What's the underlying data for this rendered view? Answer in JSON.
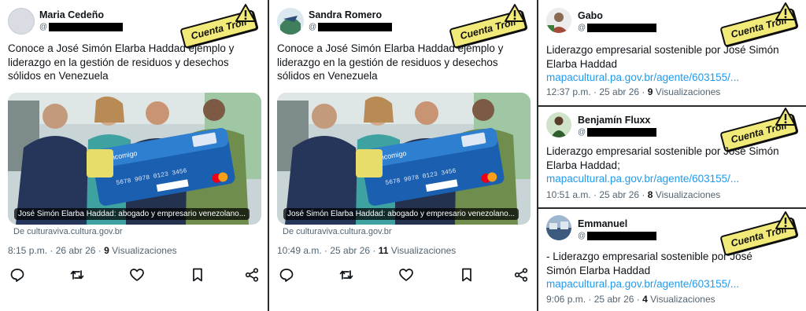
{
  "stamp_label": "Cuenta Troll",
  "tweets": [
    {
      "name": "Maria Cedeño",
      "handle_prefix": "@",
      "text": "Conoce a José Simón Elarba Haddad ejemplo y liderazgo en la gestión de residuos y desechos sólidos en Venezuela",
      "media_caption": "José Simón Elarba Haddad: abogado y empresario venezolano...",
      "source": "De culturaviva.cultura.gov.br",
      "time": "8:15 p.m.",
      "date": "26 abr 26",
      "views": "9",
      "views_label": "Visualizaciones"
    },
    {
      "name": "Sandra Romero",
      "handle_prefix": "@",
      "text": "Conoce a José Simón Elarba Haddad ejemplo y liderazgo en la gestión de residuos y desechos sólidos en Venezuela",
      "media_caption": "José Simón Elarba Haddad: abogado y empresario venezolano...",
      "source": "De culturaviva.cultura.gov.br",
      "time": "10:49 a.m.",
      "date": "25 abr 26",
      "views": "11",
      "views_label": "Visualizaciones"
    },
    {
      "name": "Gabo",
      "handle_prefix": "@",
      "text": "Liderazgo empresarial sostenible por José Simón Elarba Haddad",
      "link": "mapacultural.pa.gov.br/agente/603155/...",
      "time": "12:37 p.m.",
      "date": "25 abr 26",
      "views": "9",
      "views_label": "Visualizaciones"
    },
    {
      "name": "Benjamín Fluxx",
      "handle_prefix": "@",
      "text": "Liderazgo empresarial sostenible por José Simón Elarba Haddad;",
      "link": "mapacultural.pa.gov.br/agente/603155/...",
      "time": "10:51 a.m.",
      "date": "25 abr 26",
      "views": "8",
      "views_label": "Visualizaciones"
    },
    {
      "name": "Emmanuel",
      "handle_prefix": "@",
      "text": "-  Liderazgo empresarial sostenible por José Simón Elarba Haddad",
      "link": "mapacultural.pa.gov.br/agente/603155/...",
      "time": "9:06 p.m.",
      "date": "25 abr 26",
      "views": "4",
      "views_label": "Visualizaciones"
    }
  ],
  "actions": [
    "reply-icon",
    "retweet-icon",
    "like-icon",
    "bookmark-icon",
    "share-icon"
  ],
  "colors": {
    "link": "#1d9bf0",
    "stamp": "#f2ea78",
    "text": "#0f1419",
    "muted": "#536471"
  }
}
